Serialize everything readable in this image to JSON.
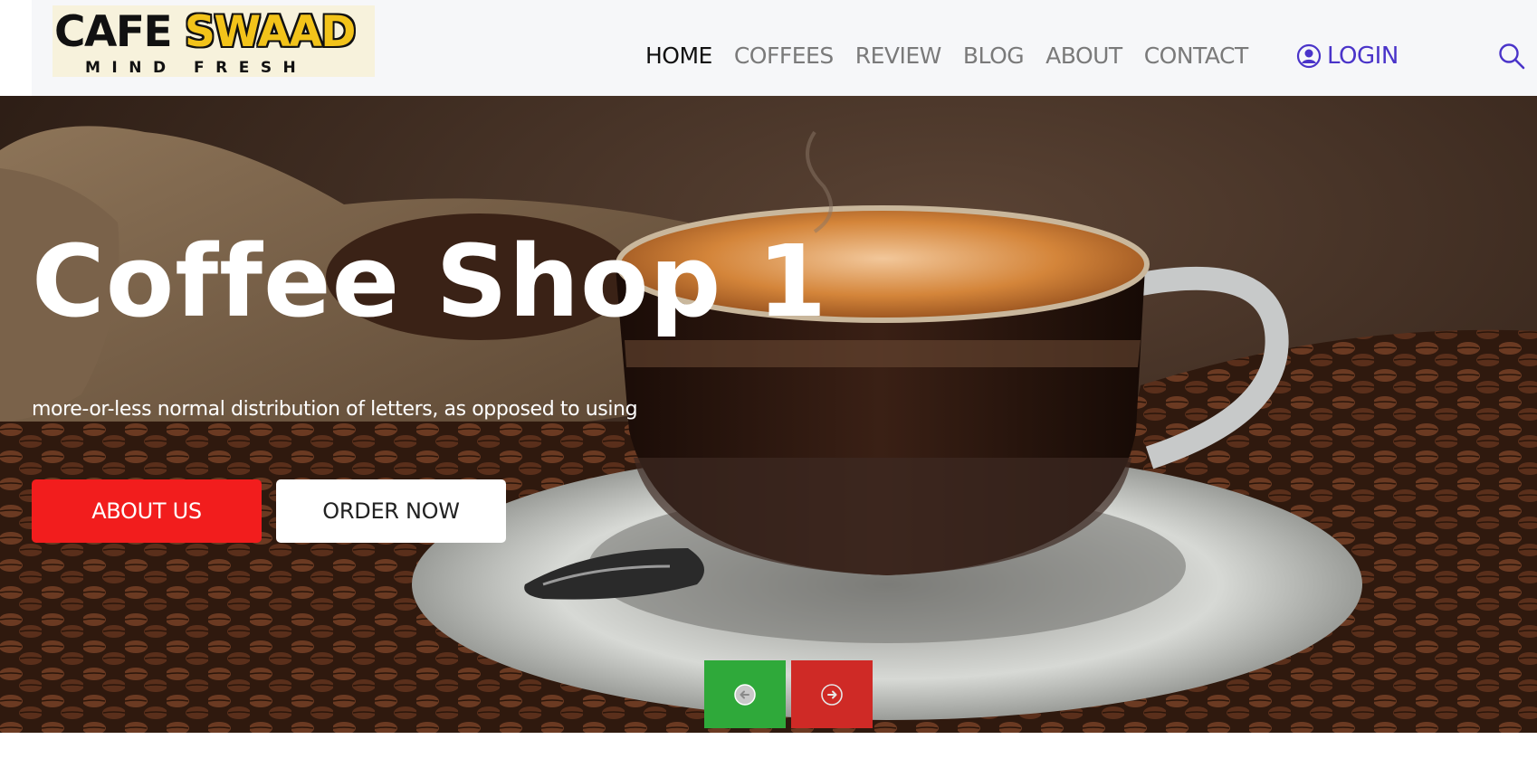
{
  "brand": {
    "name_part1": "CAFE",
    "name_part2": "SWAAD",
    "tagline": "MIND FRESH"
  },
  "nav": {
    "items": [
      {
        "label": "HOME",
        "active": true
      },
      {
        "label": "COFFEES",
        "active": false
      },
      {
        "label": "REVIEW",
        "active": false
      },
      {
        "label": "BLOG",
        "active": false
      },
      {
        "label": "ABOUT",
        "active": false
      },
      {
        "label": "CONTACT",
        "active": false
      }
    ],
    "login_label": "LOGIN",
    "login_icon": "user-circle-icon",
    "search_icon": "search-icon"
  },
  "hero": {
    "title": "Coffee Shop 1",
    "subtitle": "more-or-less normal distribution of letters, as opposed to using",
    "primary_button": "ABOUT US",
    "secondary_button": "ORDER NOW",
    "prev_icon": "arrow-left-circle-icon",
    "next_icon": "arrow-right-circle-icon"
  },
  "colors": {
    "brand_yellow": "#f2c31a",
    "accent_purple": "#4a34c9",
    "primary_red": "#f21d1d",
    "prev_green": "#2fa93a",
    "next_red": "#cf2a26"
  }
}
